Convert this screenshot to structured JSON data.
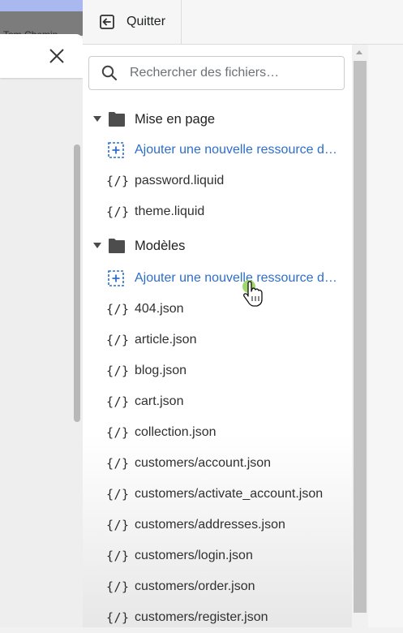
{
  "background": {
    "user_name": "Tom Chemin"
  },
  "header": {
    "quit_label": "Quitter"
  },
  "search": {
    "placeholder": "Rechercher des fichiers…",
    "value": ""
  },
  "colors": {
    "link": "#2c6ecb",
    "cursor_highlight": "#8fd14f"
  },
  "tree": {
    "layout_folder": {
      "label": "Mise en page",
      "add_label": "Ajouter une nouvelle ressource de mise en page",
      "files": [
        "password.liquid",
        "theme.liquid"
      ]
    },
    "templates_folder": {
      "label": "Modèles",
      "add_label": "Ajouter une nouvelle ressource de modèle",
      "files": [
        "404.json",
        "article.json",
        "blog.json",
        "cart.json",
        "collection.json",
        "customers/account.json",
        "customers/activate_account.json",
        "customers/addresses.json",
        "customers/login.json",
        "customers/order.json",
        "customers/register.json"
      ]
    },
    "file_icon_glyph": "{/}"
  }
}
